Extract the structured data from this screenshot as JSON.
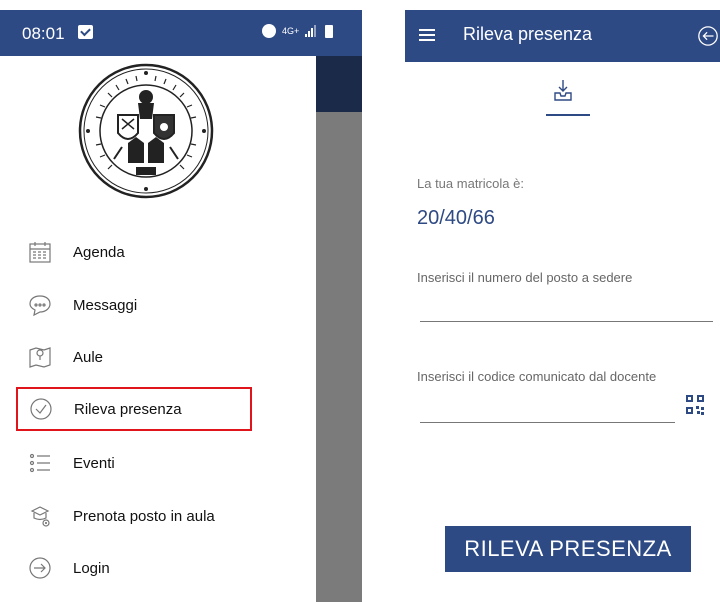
{
  "status_bar": {
    "time": "08:01",
    "network": "4G+"
  },
  "drawer": {
    "menu_items": [
      {
        "label": "Agenda",
        "icon": "calendar-icon"
      },
      {
        "label": "Messaggi",
        "icon": "chat-bubble-icon"
      },
      {
        "label": "Aule",
        "icon": "map-pin-icon"
      },
      {
        "label": "Rileva presenza",
        "icon": "check-circle-icon",
        "highlighted": true
      },
      {
        "label": "Eventi",
        "icon": "list-icon"
      },
      {
        "label": "Prenota posto in aula",
        "icon": "book-seat-icon"
      },
      {
        "label": "Login",
        "icon": "login-arrow-icon"
      }
    ]
  },
  "form": {
    "title": "Rileva presenza",
    "matricola_label": "La tua matricola è:",
    "matricola_value": "20/40/66",
    "seat_label": "Inserisci il numero del posto a sedere",
    "code_label": "Inserisci il codice comunicato dal docente",
    "submit_label": "RILEVA PRESENZA"
  },
  "colors": {
    "primary": "#2e4a84",
    "highlight_border": "#e0151b",
    "scrim": "#7b7b7b"
  }
}
